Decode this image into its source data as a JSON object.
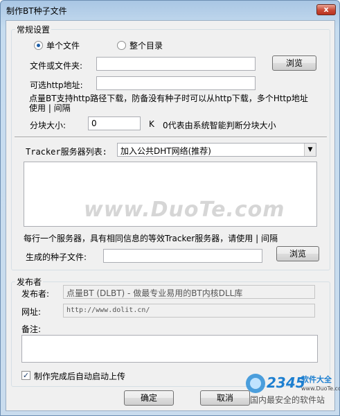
{
  "window": {
    "title": "制作BT种子文件",
    "close_label": "x"
  },
  "general": {
    "group_label": "常规设置",
    "radio_single": "单个文件",
    "radio_dir": "整个目录",
    "file_label": "文件或文件夹:",
    "file_value": "",
    "browse1": "浏览",
    "http_label": "可选http地址:",
    "http_value": "",
    "http_hint": "点量BT支持http路径下载，防备没有种子时可以从http下载，多个Http地址使用 | 间隔",
    "block_label": "分块大小:",
    "block_value": "0",
    "block_unit": "K",
    "block_hint": "0代表由系统智能判断分块大小",
    "tracker_label": "Tracker服务器列表:",
    "tracker_select": "加入公共DHT网络(推荐)",
    "tracker_hint": "每行一个服务器，具有相同信息的等效Tracker服务器，请使用 | 间隔",
    "output_label": "生成的种子文件:",
    "output_value": "",
    "browse2": "浏览"
  },
  "publisher": {
    "group_label": "发布者",
    "name_label": "发布者:",
    "name_value": "点量BT (DLBT) - 做最专业易用的BT内核DLL库",
    "url_label": "网址:",
    "url_value": "http://www.dolit.cn/",
    "note_label": "备注:",
    "note_value": ""
  },
  "auto_upload": {
    "checked": true,
    "label": "制作完成后自动启动上传"
  },
  "buttons": {
    "ok": "确定",
    "cancel": "取消"
  },
  "watermark": {
    "text": "www.DuoTe.com",
    "logo_number": "2345",
    "logo_sub": "软件大全",
    "logo_url": "www.DuoTe.com",
    "logo_caption": "国内最安全的软件站"
  }
}
